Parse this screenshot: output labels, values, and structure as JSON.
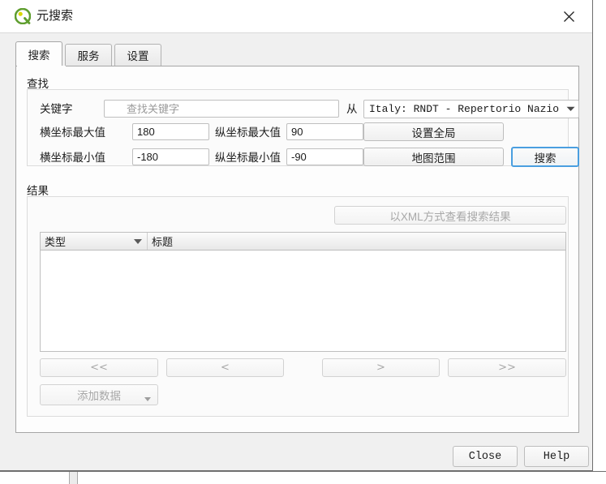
{
  "window": {
    "title": "元搜索",
    "logo_icon": "qgis-logo-icon",
    "close_icon": "close-icon"
  },
  "tabs": [
    {
      "label": "搜索",
      "active": true
    },
    {
      "label": "服务",
      "active": false
    },
    {
      "label": "设置",
      "active": false
    }
  ],
  "find_group": {
    "title": "查找",
    "keywords_label": "关键字",
    "keywords_value": "",
    "keywords_placeholder": "查找关键字",
    "search_icon": "search-icon",
    "from_label": "从",
    "service_selected": "Italy: RNDT - Repertorio Nazio",
    "service_arrow_icon": "chevron-down-icon",
    "xmax_label": "横坐标最大值",
    "xmax_value": "180",
    "ymax_label": "纵坐标最大值",
    "ymax_value": "90",
    "xmin_label": "横坐标最小值",
    "xmin_value": "-180",
    "ymin_label": "纵坐标最小值",
    "ymin_value": "-90",
    "set_global_label": "设置全局",
    "map_extent_label": "地图范围",
    "search_label": "搜索"
  },
  "results_group": {
    "title": "结果",
    "view_xml_label": "以XML方式查看搜索结果",
    "columns": [
      {
        "label": "类型",
        "sorted": true
      },
      {
        "label": "标题",
        "sorted": false
      }
    ],
    "rows": [],
    "nav": {
      "first_label": "<<",
      "prev_label": "<",
      "next_label": ">",
      "last_label": ">>"
    },
    "add_data_label": "添加数据",
    "add_data_arrow_icon": "caret-down-icon"
  },
  "footer": {
    "close_label": "Close",
    "help_label": "Help"
  },
  "colors": {
    "focus_blue": "#4a9fe0",
    "logo_green": "#5f9e2f",
    "dialog_bg": "#f0f0f0",
    "page_bg": "#fdfdfd"
  }
}
